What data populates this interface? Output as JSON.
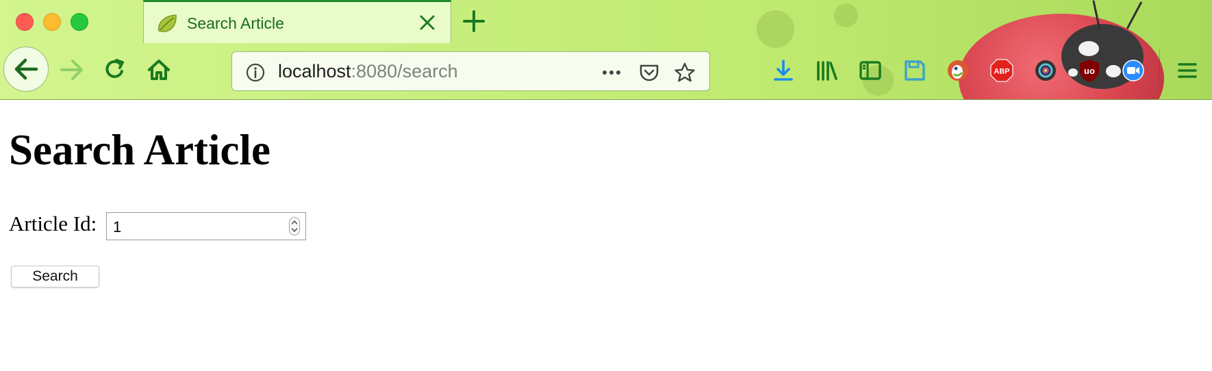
{
  "browser": {
    "tab": {
      "title": "Search Article"
    },
    "url": {
      "host": "localhost",
      "rest": ":8080/search"
    },
    "colors": {
      "chrome_green": "#c8ef7e",
      "icon_green": "#1a7a1f",
      "tab_bg": "#e9fbc8",
      "download_blue": "#1a8bf0",
      "abp_red": "#e2211c",
      "zoom_blue": "#2d8cff"
    },
    "extensions": [
      {
        "name": "duckduckgo-icon"
      },
      {
        "name": "adblock-plus-icon",
        "label": "ABP"
      },
      {
        "name": "camera-lens-icon"
      },
      {
        "name": "ublock-origin-icon",
        "label": "uo"
      },
      {
        "name": "zoom-icon"
      }
    ]
  },
  "page": {
    "title": "Search Article",
    "form": {
      "label": "Article Id:",
      "value": "1",
      "button": "Search"
    }
  }
}
